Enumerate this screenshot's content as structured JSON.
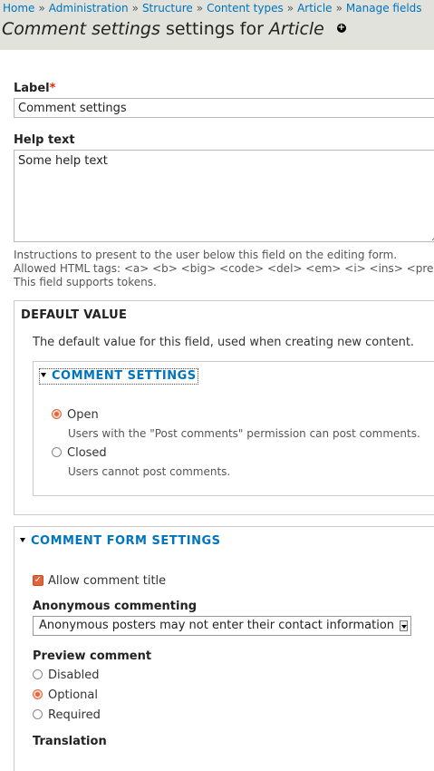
{
  "breadcrumb": [
    "Home",
    "Administration",
    "Structure",
    "Content types",
    "Article",
    "Manage fields"
  ],
  "breadcrumb_separator": "»",
  "page_title": {
    "part1": "Comment settings",
    "part2": " settings for ",
    "part3": "Article"
  },
  "label_field": {
    "label": "Label",
    "required_mark": "*",
    "value": "Comment settings"
  },
  "help_field": {
    "label": "Help text",
    "value": "Some help text",
    "description": [
      "Instructions to present to the user below this field on the editing form.",
      "Allowed HTML tags: <a> <b> <big> <code> <del> <em> <i> <ins> <pre",
      "This field supports tokens."
    ]
  },
  "default_value": {
    "legend": "DEFAULT VALUE",
    "description": "The default value for this field, used when creating new content.",
    "comment_settings": {
      "legend": "COMMENT SETTINGS",
      "options": [
        {
          "label": "Open",
          "description": "Users with the \"Post comments\" permission can post comments.",
          "checked": true
        },
        {
          "label": "Closed",
          "description": "Users cannot post comments.",
          "checked": false
        }
      ]
    }
  },
  "comment_form": {
    "legend": "COMMENT FORM SETTINGS",
    "allow_title": {
      "label": "Allow comment title",
      "checked": true
    },
    "anonymous": {
      "label": "Anonymous commenting",
      "selected": "Anonymous posters may not enter their contact information"
    },
    "preview": {
      "label": "Preview comment",
      "options": [
        {
          "label": "Disabled",
          "checked": false
        },
        {
          "label": "Optional",
          "checked": true
        },
        {
          "label": "Required",
          "checked": false
        }
      ]
    },
    "translation_label": "Translation"
  },
  "colors": {
    "link": "#0074bd",
    "accent": "#e2643b",
    "header_bg": "#e1e2dc"
  }
}
